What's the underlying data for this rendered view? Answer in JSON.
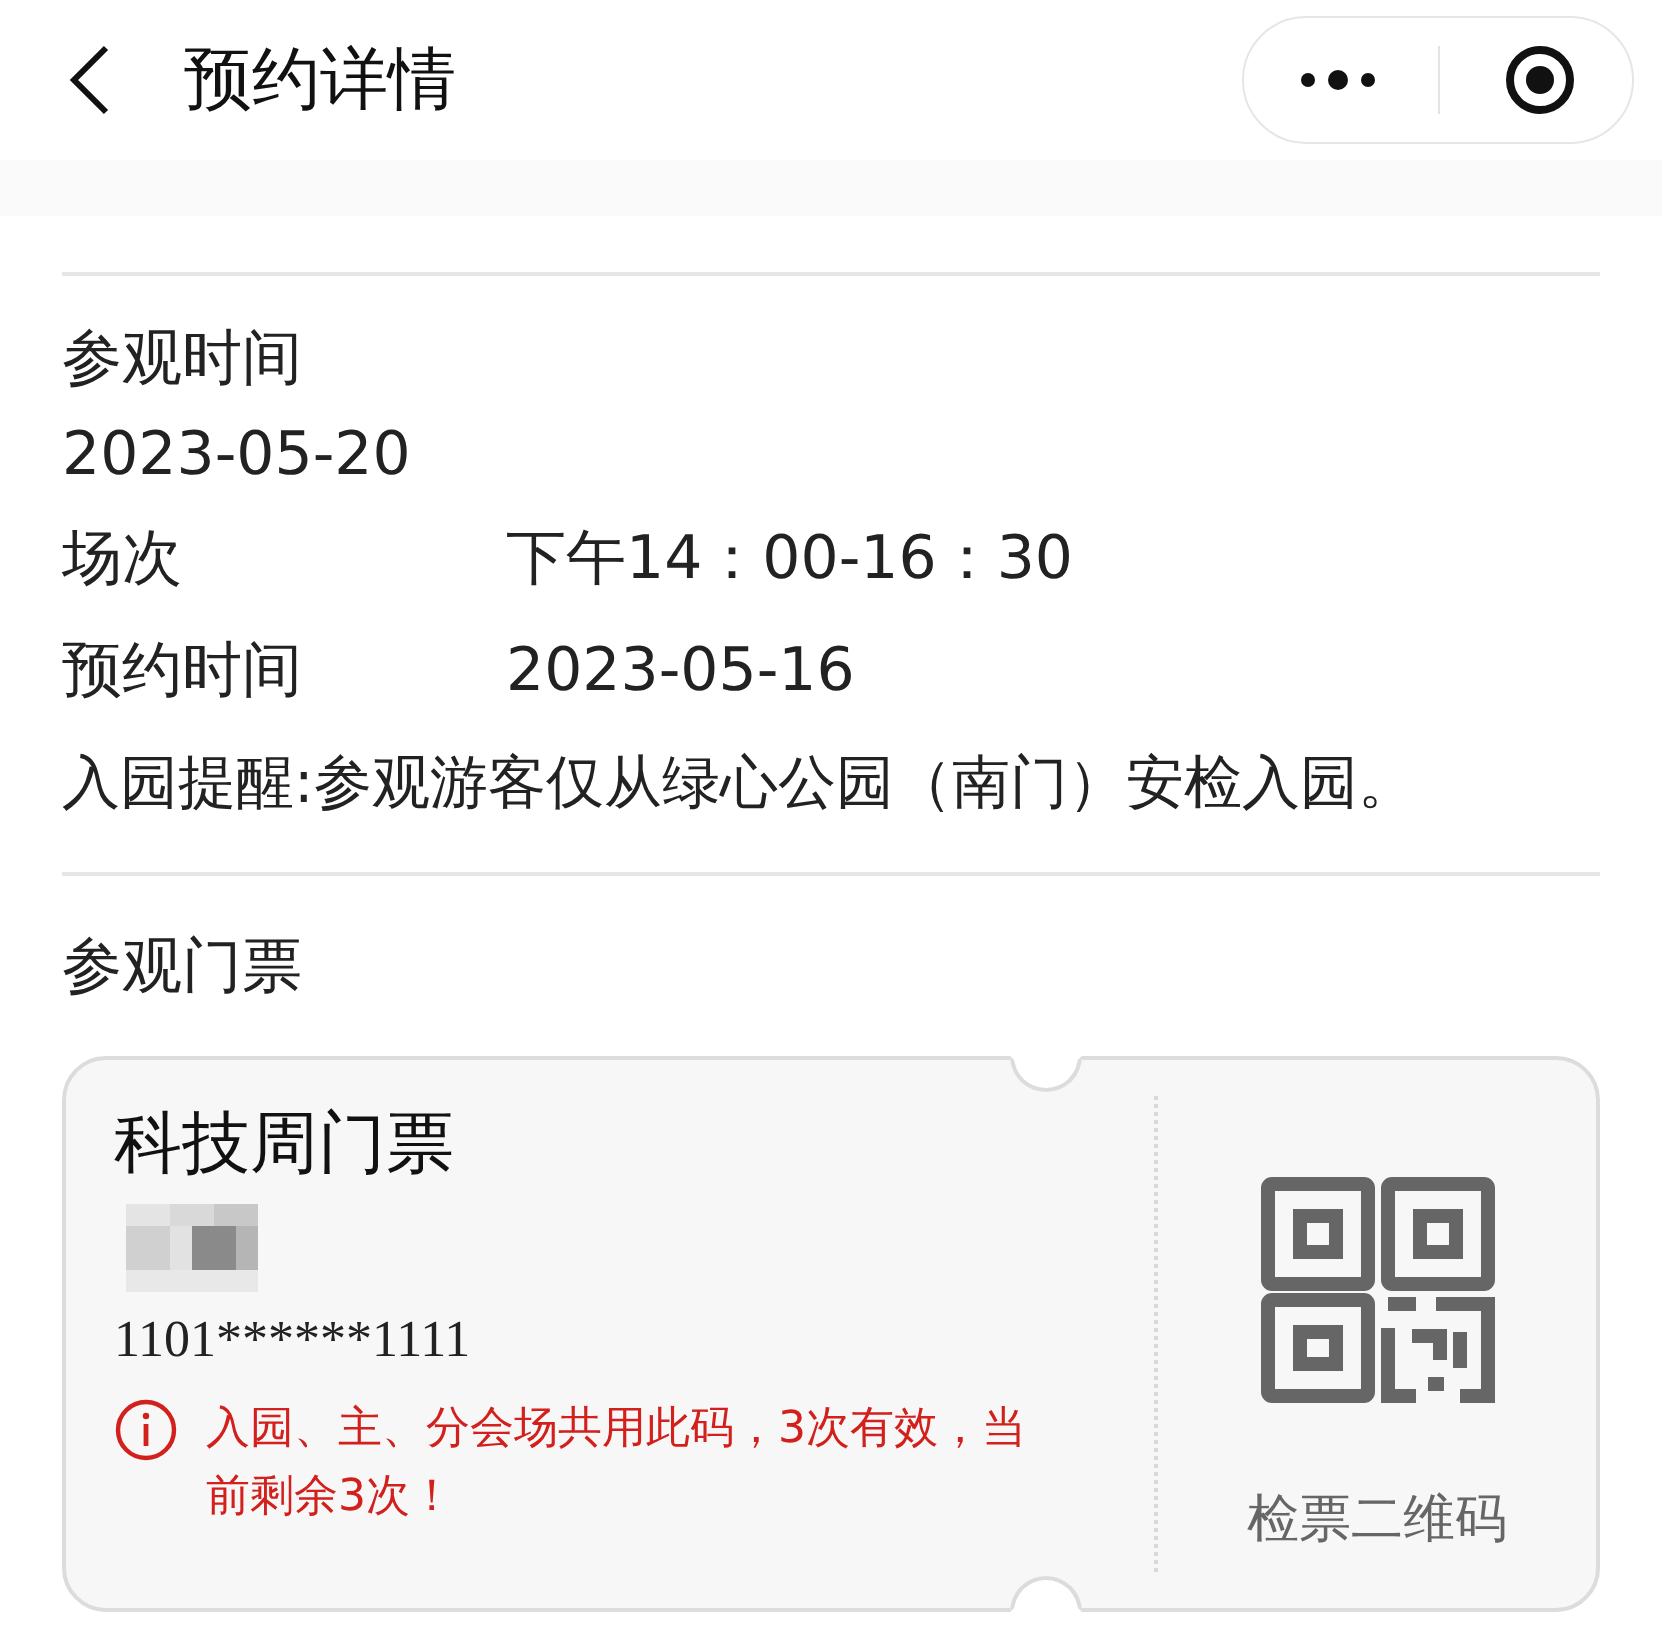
{
  "header": {
    "title": "预约详情"
  },
  "visit": {
    "label": "参观时间",
    "date": "2023-05-20"
  },
  "details": [
    {
      "label": "场次",
      "value": "下午14：00-16：30"
    },
    {
      "label": "预约时间",
      "value": "2023-05-16"
    }
  ],
  "reminder": "入园提醒:参观游客仅从绿心公园（南门）安检入园。",
  "tickets_section": {
    "title": "参观门票"
  },
  "ticket": {
    "name": "科技周门票",
    "id_number": "1101******1111",
    "notice": "入园、主、分会场共用此码，3次有效，当前剩余3次！",
    "qr_label": "检票二维码"
  }
}
